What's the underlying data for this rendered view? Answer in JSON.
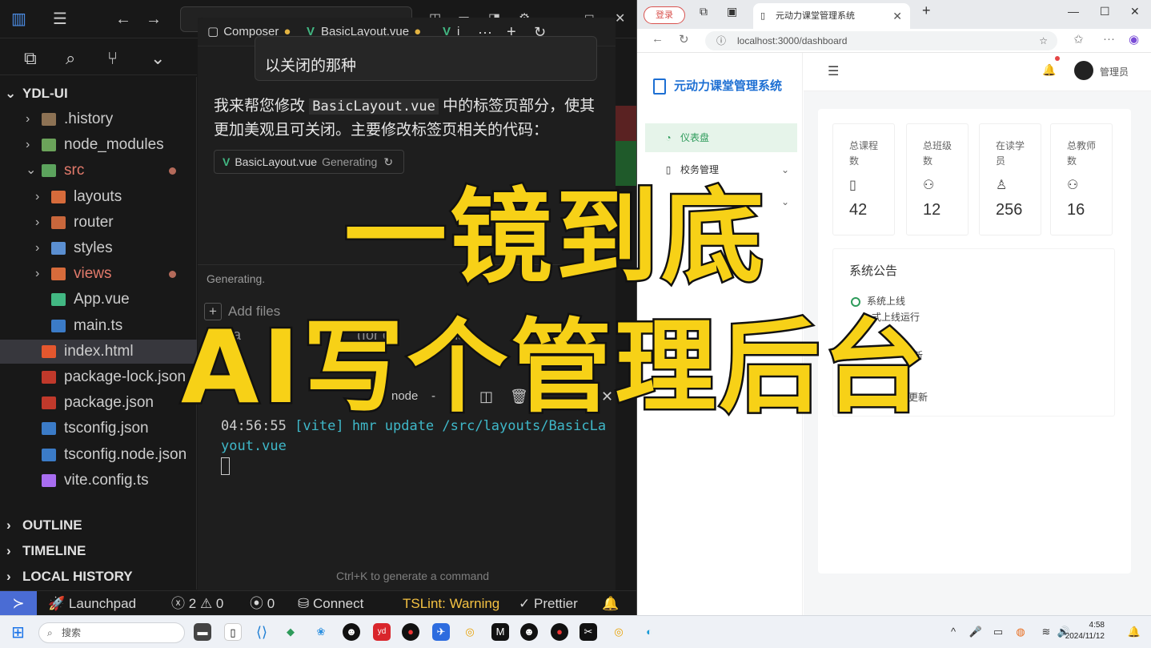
{
  "editor": {
    "explorer_root": "YDL-UI",
    "tree": [
      {
        "label": ".history",
        "kind": "folder",
        "icon": "folder-icon"
      },
      {
        "label": "node_modules",
        "kind": "folder",
        "icon": "folder-node-icon"
      },
      {
        "label": "src",
        "kind": "folder-open",
        "icon": "folder-src-icon"
      },
      {
        "label": "layouts",
        "kind": "folder",
        "icon": "folder-layout-icon"
      },
      {
        "label": "router",
        "kind": "folder",
        "icon": "folder-router-icon"
      },
      {
        "label": "styles",
        "kind": "folder",
        "icon": "folder-styles-icon"
      },
      {
        "label": "views",
        "kind": "folder",
        "icon": "folder-views-icon"
      },
      {
        "label": "App.vue",
        "kind": "file",
        "icon": "vue-icon"
      },
      {
        "label": "main.ts",
        "kind": "file",
        "icon": "ts-icon"
      },
      {
        "label": "index.html",
        "kind": "file",
        "icon": "html-icon"
      },
      {
        "label": "package-lock.json",
        "kind": "file",
        "icon": "npm-icon"
      },
      {
        "label": "package.json",
        "kind": "file",
        "icon": "npm-icon"
      },
      {
        "label": "tsconfig.json",
        "kind": "file",
        "icon": "tsconfig-icon"
      },
      {
        "label": "tsconfig.node.json",
        "kind": "file",
        "icon": "tsconfig-icon"
      },
      {
        "label": "vite.config.ts",
        "kind": "file",
        "icon": "vite-icon"
      }
    ],
    "sections": [
      "OUTLINE",
      "TIMELINE",
      "LOCAL HISTORY"
    ],
    "tabs": {
      "composer": "Composer",
      "basic_layout": "BasicLayout.vue",
      "third": "i"
    },
    "quote_tail": "以关闭的那种",
    "reply_pre": "我来帮您修改 ",
    "reply_code": "BasicLayout.vue",
    "reply_post": " 中的标签页部分，使其更加美观且可关闭。主要修改标签页相关的代码：",
    "gen_chip_file": "BasicLayout.vue",
    "gen_chip_status": "Generating",
    "generating": "Generating.",
    "add_files": "Add files",
    "default_partial": "efa",
    "default_tail": "(for c",
    "default_tail2": "ds)",
    "term_tab": "node",
    "terminal_time": "04:56:55",
    "terminal_tag": "[vite]",
    "terminal_msg": "hmr update /src/layouts/BasicLayout.vue",
    "ctrlk": "Ctrl+K to generate a command"
  },
  "statusbar": {
    "launchpad": "Launchpad",
    "errors": "2",
    "warnings": "0",
    "ports": "0",
    "connect": "Connect",
    "tslint": "TSLint: Warning",
    "prettier": "Prettier"
  },
  "browser": {
    "profile": "登录",
    "tab_title": "元动力课堂管理系统",
    "url": "localhost:3000/dashboard",
    "app_title": "元动力课堂管理系统",
    "menu": [
      {
        "label": "仪表盘",
        "icon": "dashboard-icon",
        "active": true
      },
      {
        "label": "校务管理",
        "icon": "book-icon",
        "active": false
      }
    ],
    "user": "管理员",
    "stats": [
      {
        "title": "总课程数",
        "icon": "book-icon",
        "value": "42"
      },
      {
        "title": "总班级数",
        "icon": "group-icon",
        "value": "12"
      },
      {
        "title": "在读学员",
        "icon": "user-icon",
        "value": "256"
      },
      {
        "title": "总教师数",
        "icon": "teacher-icon",
        "value": "16"
      }
    ],
    "notice_title": "系统公告",
    "notices": [
      "系统上线",
      "式上线运行",
      "新",
      "更新"
    ]
  },
  "overlay": {
    "line1": "一镜到底",
    "line2": "AI写个管理后台"
  },
  "taskbar": {
    "search": "搜索",
    "time": "4:58",
    "date": "2024/11/12"
  },
  "colors": {
    "accent_green": "#2e9b5b",
    "brand_blue": "#1d6fd3",
    "overlay_yellow": "#f7d117",
    "vue_green": "#42b883"
  }
}
